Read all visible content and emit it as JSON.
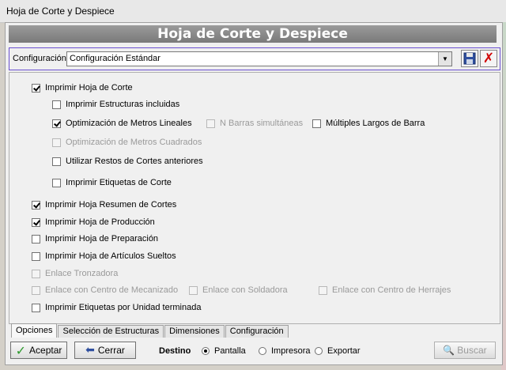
{
  "window": {
    "title": "Hoja de Corte y Despiece"
  },
  "banner": {
    "title": "Hoja de Corte y Despiece"
  },
  "config": {
    "label": "Configuración",
    "selected": "Configuración Estándar"
  },
  "options": [
    {
      "label": "Imprimir Hoja de Corte",
      "checked": true,
      "disabled": false
    },
    {
      "label": "Imprimir Estructuras incluidas",
      "checked": false,
      "disabled": false
    },
    {
      "label": "Optimización de Metros Lineales",
      "checked": true,
      "disabled": false
    },
    {
      "label": "N Barras simultáneas",
      "checked": false,
      "disabled": true
    },
    {
      "label": "Múltiples Largos de Barra",
      "checked": false,
      "disabled": false
    },
    {
      "label": "Optimización de Metros Cuadrados",
      "checked": false,
      "disabled": true
    },
    {
      "label": "Utilizar Restos de Cortes anteriores",
      "checked": false,
      "disabled": false
    },
    {
      "label": "Imprimir Etiquetas de Corte",
      "checked": false,
      "disabled": false
    },
    {
      "label": "Imprimir Hoja Resumen de Cortes",
      "checked": true,
      "disabled": false
    },
    {
      "label": "Imprimir Hoja de Producción",
      "checked": true,
      "disabled": false
    },
    {
      "label": "Imprimir Hoja de Preparación",
      "checked": false,
      "disabled": false
    },
    {
      "label": "Imprimir Hoja de Artículos Sueltos",
      "checked": false,
      "disabled": false
    },
    {
      "label": "Enlace Tronzadora",
      "checked": false,
      "disabled": true
    },
    {
      "label": "Enlace con Centro de Mecanizado",
      "checked": false,
      "disabled": true
    },
    {
      "label": "Enlace con Soldadora",
      "checked": false,
      "disabled": true
    },
    {
      "label": "Enlace con Centro de Herrajes",
      "checked": false,
      "disabled": true
    },
    {
      "label": "Imprimir Etiquetas por Unidad terminada",
      "checked": false,
      "disabled": false
    }
  ],
  "tabs": [
    "Opciones",
    "Selección de Estructuras",
    "Dimensiones",
    "Configuración"
  ],
  "buttons": {
    "accept": "Aceptar",
    "close": "Cerrar",
    "search": "Buscar"
  },
  "destino": {
    "label": "Destino",
    "options": [
      "Pantalla",
      "Impresora",
      "Exportar"
    ],
    "selected": "Pantalla"
  },
  "colors": {
    "banner": "#8a8a8a",
    "config_border": "#6a4fd0",
    "delete": "#d00000",
    "accept_check": "#2e9a2e"
  }
}
